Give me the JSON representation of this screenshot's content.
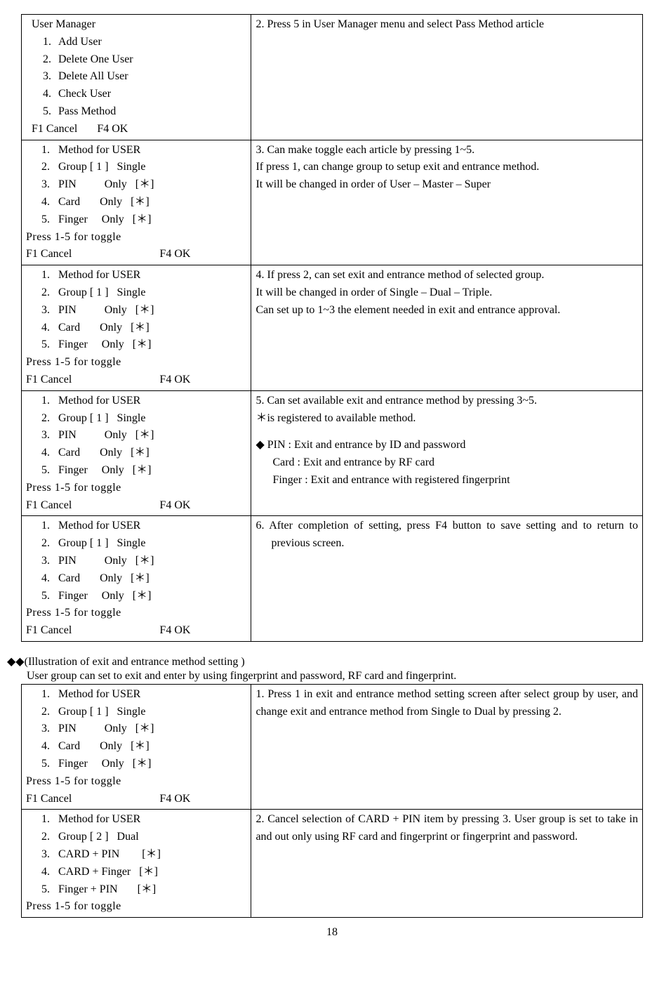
{
  "table1": {
    "row1": {
      "left": {
        "title": "User Manager",
        "items": [
          "Add User",
          "Delete One User",
          "Delete All User",
          "Check User",
          "Pass Method"
        ],
        "footer_left": "F1 Cancel",
        "footer_right": "F4 OK"
      },
      "right": "2. Press 5 in User Manager menu and select Pass Method article"
    },
    "row2": {
      "left": {
        "l1": "1.   Method for USER",
        "l2": "2.   Group [ 1 ]   Single",
        "l3": "3.   PIN          Only   [＊]",
        "l4": "4.   Card       Only   [＊]",
        "l5": "5.   Finger     Only   [＊]",
        "toggle": "Press   1-5   for toggle",
        "footer_left": "F1 Cancel",
        "footer_right": "F4 OK"
      },
      "right": "3. Can make toggle each article by pressing 1~5.\n   If press 1, can change group to setup exit and entrance method.\n   It will be changed in order of User – Master – Super"
    },
    "row3": {
      "left": {
        "l1": "1.   Method for USER",
        "l2": "2.   Group [ 1 ]   Single",
        "l3": "3.   PIN          Only   [＊]",
        "l4": "4.   Card       Only   [＊]",
        "l5": "5.   Finger     Only   [＊]",
        "toggle": "Press   1-5   for toggle",
        "footer_left": "F1 Cancel",
        "footer_right": "F4 OK"
      },
      "right": "4. If press 2, can set exit and entrance method of selected group.\n   It will be changed in order of Single – Dual – Triple.\n   Can set up to 1~3 the element needed in exit and entrance approval."
    },
    "row4": {
      "left": {
        "l1": "1.   Method for USER",
        "l2": "2.   Group [ 1 ]   Single",
        "l3": "3.   PIN          Only   [＊]",
        "l4": "4.   Card       Only   [＊]",
        "l5": "5.   Finger     Only   [＊]",
        "toggle": "Press   1-5   for toggle",
        "footer_left": "F1 Cancel",
        "footer_right": "F4 OK"
      },
      "right_p1": "5. Can set available exit and entrance method by pressing 3~5.\n  ＊is registered to available method.",
      "right_p2a": "◆ PIN : Exit and entrance by ID and password",
      "right_p2b": "Card : Exit and entrance by RF card",
      "right_p2c": "Finger : Exit and entrance with registered fingerprint"
    },
    "row5": {
      "left": {
        "l1": "1.   Method for USER",
        "l2": "2.   Group [ 1 ]   Single",
        "l3": "3.   PIN          Only   [＊]",
        "l4": "4.   Card       Only   [＊]",
        "l5": "5.   Finger     Only   [＊]",
        "toggle": "Press   1-5   for toggle",
        "footer_left": "F1 Cancel",
        "footer_right": "F4 OK"
      },
      "right": "6. After completion of setting, press F4 button   to save setting and to return to previous screen."
    }
  },
  "section": {
    "heading": "◆◆(Illustration of exit and entrance method setting )",
    "sub": "User group can set to exit and enter by using fingerprint and password, RF card and fingerprint."
  },
  "table2": {
    "row1": {
      "left": {
        "l1": "1.   Method for USER",
        "l2": "2.   Group [ 1 ]   Single",
        "l3": "3.   PIN          Only   [＊]",
        "l4": "4.   Card       Only   [＊]",
        "l5": "5.   Finger     Only   [＊]",
        "toggle": "Press   1-5   for toggle",
        "footer_left": "F1 Cancel",
        "footer_right": "F4 OK"
      },
      "right": "1. Press 1 in exit and entrance method setting screen after select group by user, and change exit and entrance method from Single to Dual by pressing 2."
    },
    "row2": {
      "left": {
        "l1": "1.   Method for USER",
        "l2": "2.   Group [ 2 ]   Dual",
        "l3": "3.   CARD + PIN        [＊]",
        "l4": "4.   CARD + Finger   [＊]",
        "l5": "5.   Finger + PIN       [＊]",
        "toggle": "Press   1-5   for toggle"
      },
      "right": "2. Cancel selection of CARD + PIN item by pressing 3. User group is set to take in and out only using RF card and fingerprint or fingerprint and password."
    }
  },
  "page_number": "18"
}
